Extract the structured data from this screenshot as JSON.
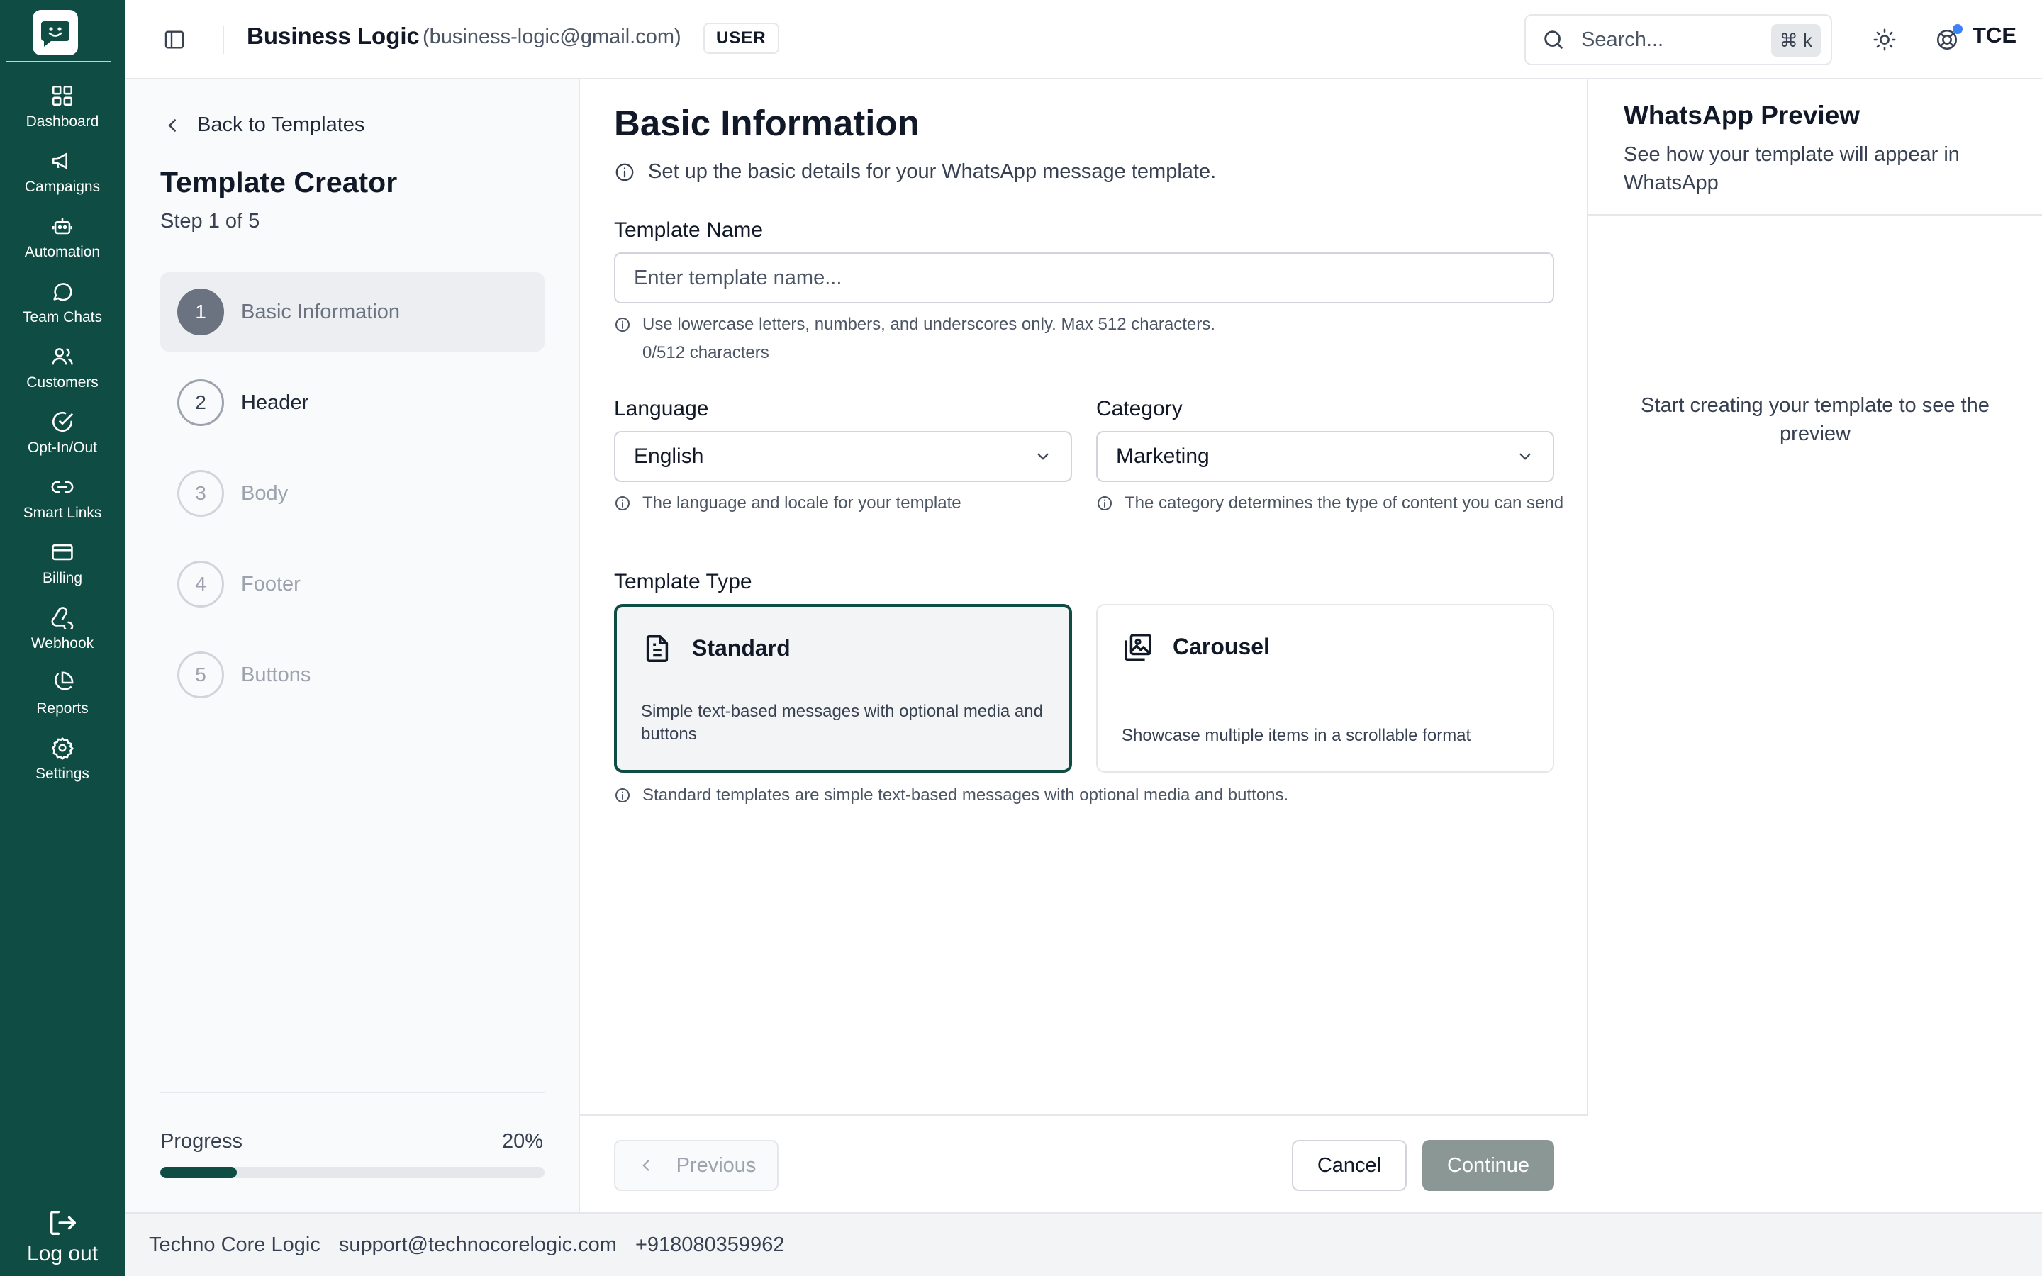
{
  "rail": {
    "items": [
      {
        "label": "Dashboard",
        "icon": "dashboard-icon"
      },
      {
        "label": "Campaigns",
        "icon": "megaphone-icon"
      },
      {
        "label": "Automation",
        "icon": "bot-icon"
      },
      {
        "label": "Team Chats",
        "icon": "chat-icon"
      },
      {
        "label": "Customers",
        "icon": "users-icon"
      },
      {
        "label": "Opt-In/Out",
        "icon": "check-circle-icon"
      },
      {
        "label": "Smart Links",
        "icon": "link-icon"
      },
      {
        "label": "Billing",
        "icon": "credit-card-icon"
      },
      {
        "label": "Webhook",
        "icon": "webhook-icon"
      },
      {
        "label": "Reports",
        "icon": "pie-chart-icon"
      },
      {
        "label": "Settings",
        "icon": "gear-icon"
      }
    ],
    "logout_label": "Log out"
  },
  "header": {
    "company": "Business Logic",
    "email": "(business-logic@gmail.com)",
    "role": "USER",
    "search_placeholder": "Search...",
    "search_shortcut": "⌘ k",
    "avatar": "TCE"
  },
  "steps_panel": {
    "back_label": "Back to Templates",
    "title": "Template Creator",
    "step_indicator": "Step 1 of 5",
    "steps": [
      {
        "num": "1",
        "label": "Basic Information"
      },
      {
        "num": "2",
        "label": "Header"
      },
      {
        "num": "3",
        "label": "Body"
      },
      {
        "num": "4",
        "label": "Footer"
      },
      {
        "num": "5",
        "label": "Buttons"
      }
    ],
    "progress_label": "Progress",
    "progress_text": "20%",
    "progress_value": 0.2
  },
  "form": {
    "title": "Basic Information",
    "subtitle": "Set up the basic details for your WhatsApp message template.",
    "template_name_label": "Template Name",
    "template_name_placeholder": "Enter template name...",
    "template_name_value": "",
    "template_name_hint": "Use lowercase letters, numbers, and underscores only. Max 512 characters.",
    "char_count": "0/512 characters",
    "language_label": "Language",
    "language_value": "English",
    "language_hint": "The language and locale for your template",
    "category_label": "Category",
    "category_value": "Marketing",
    "category_hint": "The category determines the type of content you can send",
    "type_label": "Template Type",
    "types": [
      {
        "title": "Standard",
        "desc": "Simple text-based messages with optional media and buttons",
        "selected": true
      },
      {
        "title": "Carousel",
        "desc": "Showcase multiple items in a scrollable format",
        "selected": false
      }
    ],
    "type_hint": "Standard templates are simple text-based messages with optional media and buttons.",
    "previous_label": "Previous",
    "cancel_label": "Cancel",
    "continue_label": "Continue"
  },
  "preview": {
    "title": "WhatsApp Preview",
    "subtitle": "See how your template will appear in WhatsApp",
    "empty_text": "Start creating your template to see the preview"
  },
  "footer": {
    "company": "Techno Core Logic",
    "email": "support@technocorelogic.com",
    "phone": "+918080359962"
  },
  "colors": {
    "brand": "#0f4c43",
    "continue_disabled": "#8a9794",
    "notification": "#3b82f6"
  }
}
